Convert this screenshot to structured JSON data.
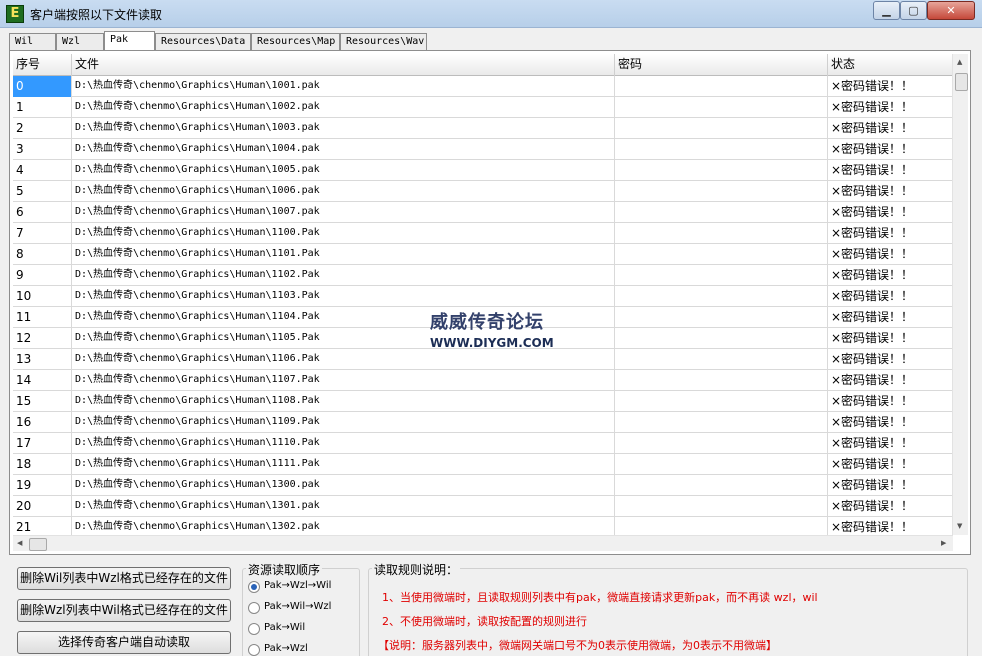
{
  "window": {
    "title": "客户端按照以下文件读取",
    "icon_letter": "E",
    "min": "▁",
    "max": "▢",
    "close": "✕"
  },
  "tabs": [
    "Wil",
    "Wzl",
    "Pak",
    "Resources\\Data",
    "Resources\\Map",
    "Resources\\Wav"
  ],
  "active_tab": "Pak",
  "grid": {
    "headers": [
      "序号",
      "文件",
      "密码",
      "状态"
    ],
    "rows": [
      {
        "no": "0",
        "file": "D:\\热血传奇\\chenmo\\Graphics\\Human\\1001.pak",
        "password": "",
        "status": "×密码错误！！"
      },
      {
        "no": "1",
        "file": "D:\\热血传奇\\chenmo\\Graphics\\Human\\1002.pak",
        "password": "",
        "status": "×密码错误！！"
      },
      {
        "no": "2",
        "file": "D:\\热血传奇\\chenmo\\Graphics\\Human\\1003.pak",
        "password": "",
        "status": "×密码错误！！"
      },
      {
        "no": "3",
        "file": "D:\\热血传奇\\chenmo\\Graphics\\Human\\1004.pak",
        "password": "",
        "status": "×密码错误！！"
      },
      {
        "no": "4",
        "file": "D:\\热血传奇\\chenmo\\Graphics\\Human\\1005.pak",
        "password": "",
        "status": "×密码错误！！"
      },
      {
        "no": "5",
        "file": "D:\\热血传奇\\chenmo\\Graphics\\Human\\1006.pak",
        "password": "",
        "status": "×密码错误！！"
      },
      {
        "no": "6",
        "file": "D:\\热血传奇\\chenmo\\Graphics\\Human\\1007.pak",
        "password": "",
        "status": "×密码错误！！"
      },
      {
        "no": "7",
        "file": "D:\\热血传奇\\chenmo\\Graphics\\Human\\1100.Pak",
        "password": "",
        "status": "×密码错误！！"
      },
      {
        "no": "8",
        "file": "D:\\热血传奇\\chenmo\\Graphics\\Human\\1101.Pak",
        "password": "",
        "status": "×密码错误！！"
      },
      {
        "no": "9",
        "file": "D:\\热血传奇\\chenmo\\Graphics\\Human\\1102.Pak",
        "password": "",
        "status": "×密码错误！！"
      },
      {
        "no": "10",
        "file": "D:\\热血传奇\\chenmo\\Graphics\\Human\\1103.Pak",
        "password": "",
        "status": "×密码错误！！"
      },
      {
        "no": "11",
        "file": "D:\\热血传奇\\chenmo\\Graphics\\Human\\1104.Pak",
        "password": "",
        "status": "×密码错误！！"
      },
      {
        "no": "12",
        "file": "D:\\热血传奇\\chenmo\\Graphics\\Human\\1105.Pak",
        "password": "",
        "status": "×密码错误！！"
      },
      {
        "no": "13",
        "file": "D:\\热血传奇\\chenmo\\Graphics\\Human\\1106.Pak",
        "password": "",
        "status": "×密码错误！！"
      },
      {
        "no": "14",
        "file": "D:\\热血传奇\\chenmo\\Graphics\\Human\\1107.Pak",
        "password": "",
        "status": "×密码错误！！"
      },
      {
        "no": "15",
        "file": "D:\\热血传奇\\chenmo\\Graphics\\Human\\1108.Pak",
        "password": "",
        "status": "×密码错误！！"
      },
      {
        "no": "16",
        "file": "D:\\热血传奇\\chenmo\\Graphics\\Human\\1109.Pak",
        "password": "",
        "status": "×密码错误！！"
      },
      {
        "no": "17",
        "file": "D:\\热血传奇\\chenmo\\Graphics\\Human\\1110.Pak",
        "password": "",
        "status": "×密码错误！！"
      },
      {
        "no": "18",
        "file": "D:\\热血传奇\\chenmo\\Graphics\\Human\\1111.Pak",
        "password": "",
        "status": "×密码错误！！"
      },
      {
        "no": "19",
        "file": "D:\\热血传奇\\chenmo\\Graphics\\Human\\1300.pak",
        "password": "",
        "status": "×密码错误！！"
      },
      {
        "no": "20",
        "file": "D:\\热血传奇\\chenmo\\Graphics\\Human\\1301.pak",
        "password": "",
        "status": "×密码错误！！"
      },
      {
        "no": "21",
        "file": "D:\\热血传奇\\chenmo\\Graphics\\Human\\1302.pak",
        "password": "",
        "status": "×密码错误！！"
      }
    ]
  },
  "watermark": {
    "line1": "威威传奇论坛",
    "line2": "WWW.DIYGM.COM"
  },
  "actions": {
    "delete_wil": "删除Wil列表中Wzl格式已经存在的文件",
    "delete_wzl": "删除Wzl列表中Wil格式已经存在的文件",
    "select_client": "选择传奇客户端自动读取"
  },
  "order": {
    "title": "资源读取顺序",
    "options": [
      {
        "label": "Pak→Wzl→Wil",
        "selected": true
      },
      {
        "label": "Pak→Wil→Wzl",
        "selected": false
      },
      {
        "label": "Pak→Wil",
        "selected": false
      },
      {
        "label": "Pak→Wzl",
        "selected": false
      }
    ]
  },
  "rules": {
    "title": "读取规则说明：",
    "lines": [
      "1、当使用微端时，且读取规则列表中有pak，微端直接请求更新pak，而不再读 wzl，wil",
      "2、不使用微端时，读取按配置的规则进行",
      "【说明：服务器列表中，微端网关端口号不为0表示使用微端，为0表示不用微端】"
    ]
  }
}
